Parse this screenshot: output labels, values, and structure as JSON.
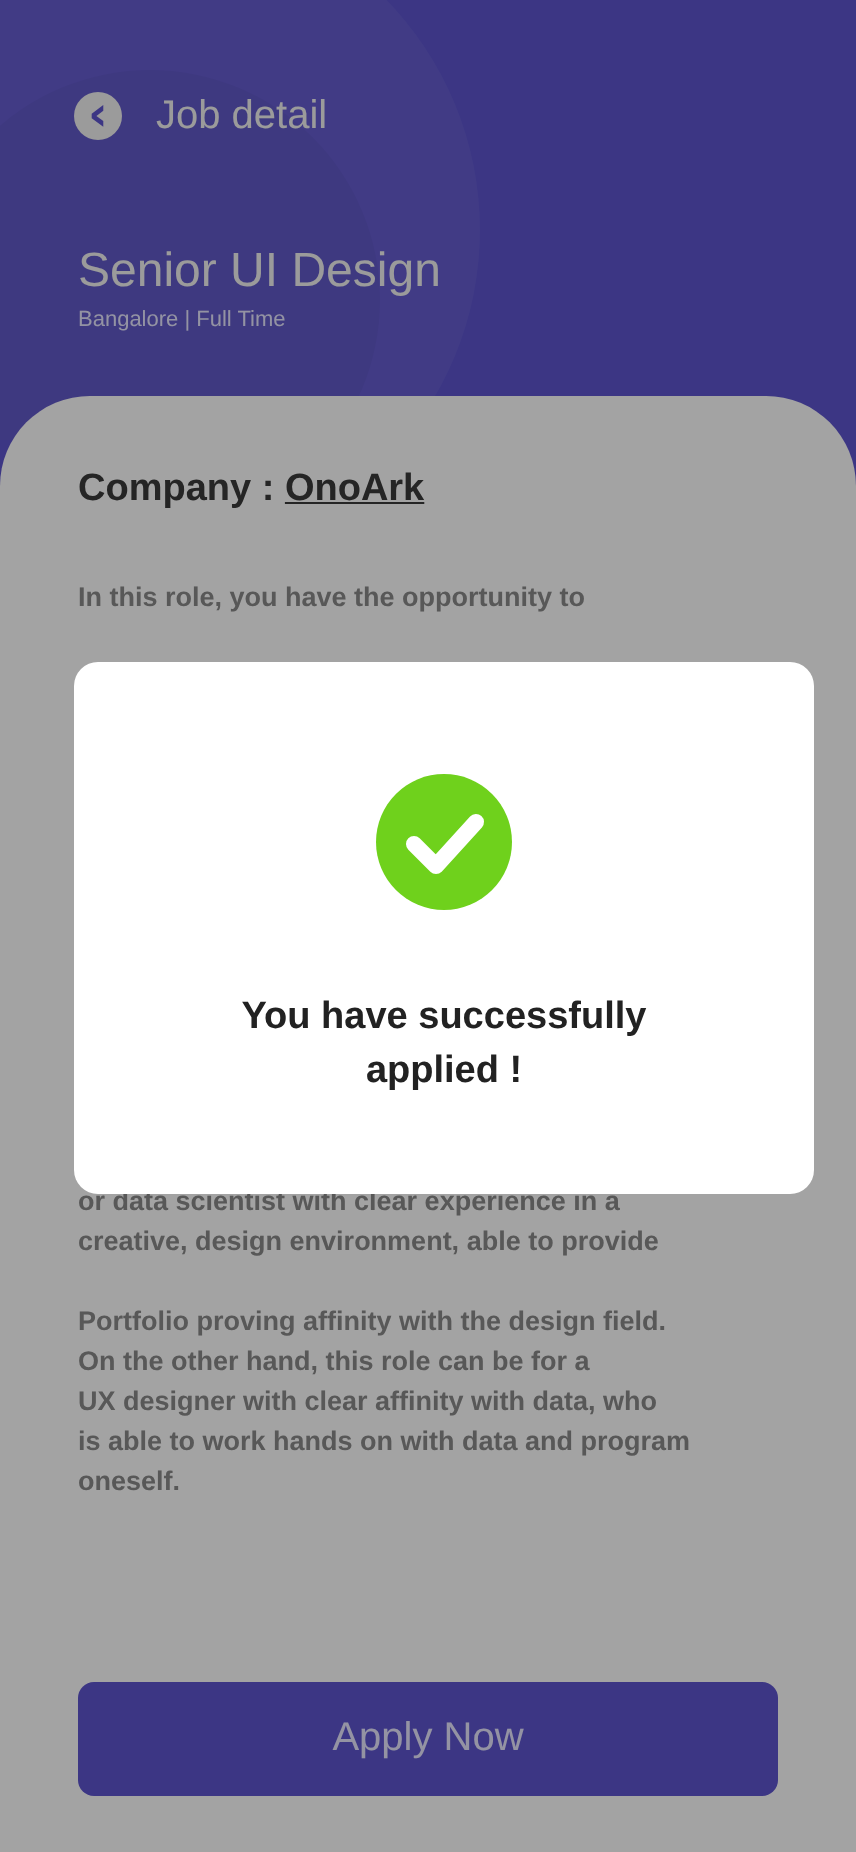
{
  "header": {
    "back_icon": "‹",
    "title": "Job detail",
    "job_title": "Senior UI Design",
    "job_meta": "Bangalore | Full Time"
  },
  "company": {
    "label": "Company : ",
    "name": "OnoArk"
  },
  "description": {
    "intro": "In this role, you have the opportunity to",
    "continuation": "or data scientist with clear experience in a\ncreative, design environment, able to provide",
    "paragraph": "Portfolio proving affinity with the design field.\nOn the other hand, this role can be for a\nUX designer with clear affinity with data, who\nis able to work hands on with data and program\noneself."
  },
  "apply_button": {
    "label": "Apply Now"
  },
  "dialog": {
    "open": true,
    "message": "You have successfully\napplied !"
  }
}
